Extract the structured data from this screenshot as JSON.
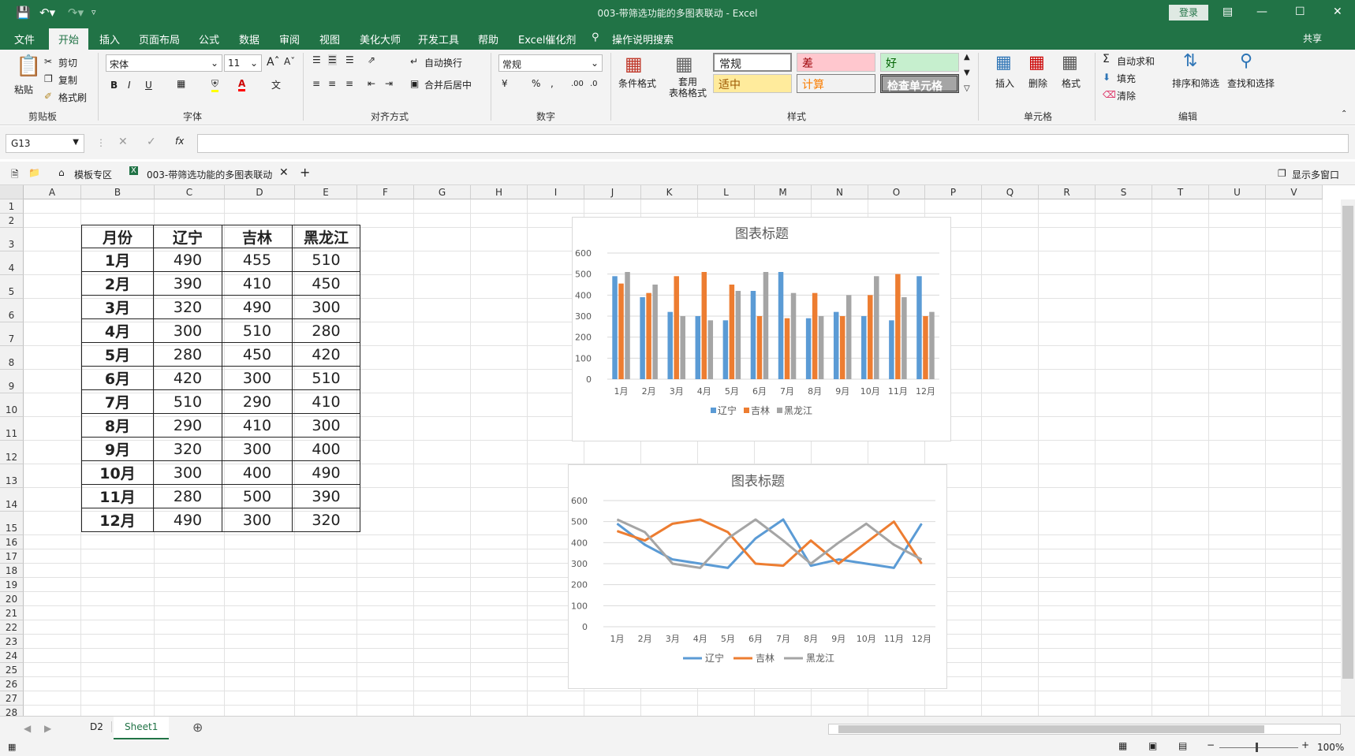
{
  "titlebar": {
    "title": "003-带筛选功能的多图表联动  -  Excel",
    "login": "登录"
  },
  "menu": {
    "tabs": [
      "文件",
      "开始",
      "插入",
      "页面布局",
      "公式",
      "数据",
      "审阅",
      "视图",
      "美化大师",
      "开发工具",
      "帮助",
      "Excel催化剂"
    ],
    "search": "操作说明搜索",
    "share": "共享"
  },
  "ribbon": {
    "clipboard": {
      "paste": "粘贴",
      "cut": "剪切",
      "copy": "复制",
      "format_painter": "格式刷",
      "group": "剪贴板"
    },
    "font": {
      "name": "宋体",
      "size": "11",
      "group": "字体"
    },
    "align": {
      "wrap": "自动换行",
      "merge": "合并后居中",
      "group": "对齐方式"
    },
    "number": {
      "format": "常规",
      "group": "数字"
    },
    "styles": {
      "cond": "条件格式",
      "table": "套用\n表格格式",
      "normal": "常规",
      "bad": "差",
      "good": "好",
      "neutral": "适中",
      "calc": "计算",
      "check": "检查单元格",
      "group": "样式"
    },
    "cells": {
      "insert": "插入",
      "delete": "删除",
      "format": "格式",
      "group": "单元格"
    },
    "edit": {
      "autosum": "自动求和",
      "fill": "填充",
      "clear": "清除",
      "sort": "排序和筛选",
      "find": "查找和选择",
      "group": "编辑"
    }
  },
  "formula": {
    "namebox": "G13",
    "value": ""
  },
  "doc_tabs": {
    "template": "模板专区",
    "file": "003-带筛选功能的多图表联动",
    "show_window": "显示多窗口"
  },
  "columns": [
    "A",
    "B",
    "C",
    "D",
    "E",
    "F",
    "G",
    "H",
    "I",
    "J",
    "K",
    "L",
    "M",
    "N",
    "O",
    "P",
    "Q",
    "R",
    "S",
    "T",
    "U",
    "V"
  ],
  "rows": [
    "1",
    "2",
    "3",
    "4",
    "5",
    "6",
    "7",
    "8",
    "9",
    "10",
    "11",
    "12",
    "13",
    "14",
    "15",
    "16",
    "17",
    "18",
    "19",
    "20",
    "21",
    "22",
    "23",
    "24",
    "25",
    "26",
    "27",
    "28"
  ],
  "table": {
    "headers": [
      "月份",
      "辽宁",
      "吉林",
      "黑龙江"
    ],
    "rows": [
      [
        "1月",
        "490",
        "455",
        "510"
      ],
      [
        "2月",
        "390",
        "410",
        "450"
      ],
      [
        "3月",
        "320",
        "490",
        "300"
      ],
      [
        "4月",
        "300",
        "510",
        "280"
      ],
      [
        "5月",
        "280",
        "450",
        "420"
      ],
      [
        "6月",
        "420",
        "300",
        "510"
      ],
      [
        "7月",
        "510",
        "290",
        "410"
      ],
      [
        "8月",
        "290",
        "410",
        "300"
      ],
      [
        "9月",
        "320",
        "300",
        "400"
      ],
      [
        "10月",
        "300",
        "400",
        "490"
      ],
      [
        "11月",
        "280",
        "500",
        "390"
      ],
      [
        "12月",
        "490",
        "300",
        "320"
      ]
    ]
  },
  "chart_data": [
    {
      "type": "bar",
      "title": "图表标题",
      "categories": [
        "1月",
        "2月",
        "3月",
        "4月",
        "5月",
        "6月",
        "7月",
        "8月",
        "9月",
        "10月",
        "11月",
        "12月"
      ],
      "series": [
        {
          "name": "辽宁",
          "values": [
            490,
            390,
            320,
            300,
            280,
            420,
            510,
            290,
            320,
            300,
            280,
            490
          ],
          "color": "#5b9bd5"
        },
        {
          "name": "吉林",
          "values": [
            455,
            410,
            490,
            510,
            450,
            300,
            290,
            410,
            300,
            400,
            500,
            300
          ],
          "color": "#ed7d31"
        },
        {
          "name": "黑龙江",
          "values": [
            510,
            450,
            300,
            280,
            420,
            510,
            410,
            300,
            400,
            490,
            390,
            320
          ],
          "color": "#a5a5a5"
        }
      ],
      "ylim": [
        0,
        600
      ],
      "yticks": [
        "0",
        "100",
        "200",
        "300",
        "400",
        "500",
        "600"
      ],
      "legend": "bottom",
      "grid": true
    },
    {
      "type": "line",
      "title": "图表标题",
      "categories": [
        "1月",
        "2月",
        "3月",
        "4月",
        "5月",
        "6月",
        "7月",
        "8月",
        "9月",
        "10月",
        "11月",
        "12月"
      ],
      "series": [
        {
          "name": "辽宁",
          "values": [
            490,
            390,
            320,
            300,
            280,
            420,
            510,
            290,
            320,
            300,
            280,
            490
          ],
          "color": "#5b9bd5"
        },
        {
          "name": "吉林",
          "values": [
            455,
            410,
            490,
            510,
            450,
            300,
            290,
            410,
            300,
            400,
            500,
            300
          ],
          "color": "#ed7d31"
        },
        {
          "name": "黑龙江",
          "values": [
            510,
            450,
            300,
            280,
            420,
            510,
            410,
            300,
            400,
            490,
            390,
            320
          ],
          "color": "#a5a5a5"
        }
      ],
      "ylim": [
        0,
        600
      ],
      "yticks": [
        "0",
        "100",
        "200",
        "300",
        "400",
        "500",
        "600"
      ],
      "legend": "bottom",
      "grid": true
    }
  ],
  "sheets": {
    "tabs": [
      "D2",
      "Sheet1"
    ],
    "active": "Sheet1"
  },
  "status": {
    "zoom": "100%"
  }
}
